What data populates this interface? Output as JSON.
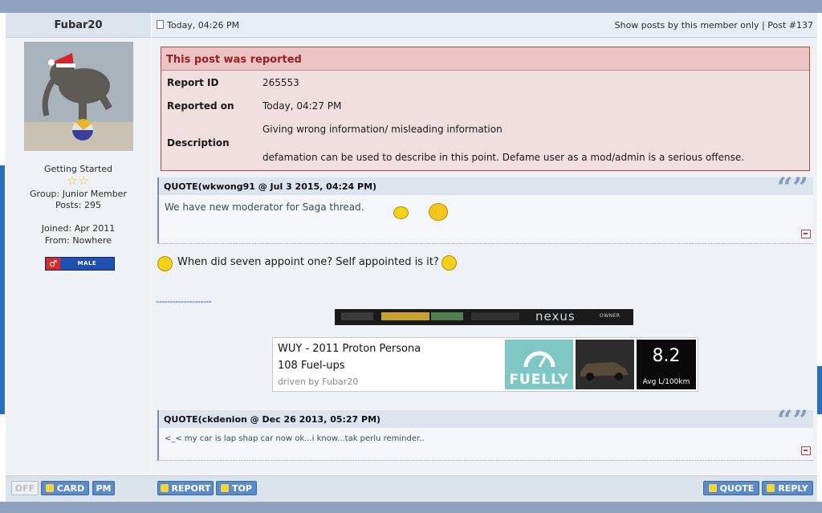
{
  "user": {
    "name": "Fubar20",
    "title": "Getting Started",
    "group": "Group: Junior Member",
    "posts": "Posts: 295",
    "joined": "Joined: Apr 2011",
    "from": "From: Nowhere",
    "gender_badge": "MALE",
    "gender_symbol": "♂",
    "stars": "☆☆"
  },
  "post": {
    "time": "Today, 04:26 PM",
    "links": "Show posts by this member only | Post #137"
  },
  "report": {
    "title": "This post was reported",
    "id_label": "Report ID",
    "id_value": "265553",
    "on_label": "Reported on",
    "on_value": "Today, 04:27 PM",
    "desc_label": "Description",
    "desc_line1": "Giving wrong information/ misleading information",
    "desc_line2": "defamation can be used to describe in this point. Defame user as a mod/admin is a serious offense."
  },
  "quote1": {
    "header": "QUOTE(wkwong91 @ Jul 3 2015, 04:24 PM)",
    "body": "We have new moderator for Saga thread."
  },
  "message": "When did seven appoint one? Self appointed is it?",
  "signature": {
    "divider": "--------------------",
    "nexus_text": "nexus",
    "nexus_owner": "OWNER",
    "car": "WUY - 2011 Proton Persona",
    "fuelups": "108 Fuel-ups",
    "driver": "driven by Fubar20",
    "logo": "FUELLY",
    "avg": "8.2",
    "unit": "Avg L/100km"
  },
  "quote2": {
    "header": "QUOTE(ckdenion @ Dec 26 2013, 05:27 PM)",
    "body": "<_< my car is lap shap car now ok...i know...tak perlu reminder.."
  },
  "buttons": {
    "off": "OFF",
    "card": "CARD",
    "pm": "PM",
    "report": "REPORT",
    "top": "TOP",
    "quote": "QUOTE",
    "reply": "REPLY"
  }
}
